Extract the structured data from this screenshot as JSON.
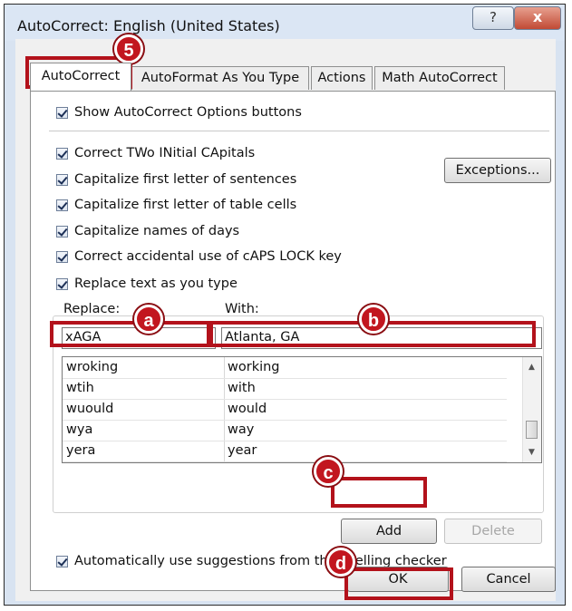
{
  "dialog": {
    "title": "AutoCorrect: English (United States)",
    "help_label": "?",
    "close_label": "x"
  },
  "tabs": [
    {
      "label": "AutoCorrect"
    },
    {
      "label": "AutoFormat As You Type"
    },
    {
      "label": "Actions"
    },
    {
      "label": "Math AutoCorrect"
    }
  ],
  "options": {
    "show_buttons": "Show AutoCorrect Options buttons",
    "correct_two_initial": "Correct TWo INitial CApitals",
    "cap_sentences": "Capitalize first letter of sentences",
    "cap_table_cells": "Capitalize first letter of table cells",
    "cap_days": "Capitalize names of days",
    "caps_lock": "Correct accidental use of cAPS LOCK key",
    "replace_as_type": "Replace text as you type",
    "auto_suggest": "Automatically use suggestions from the spelling checker"
  },
  "buttons": {
    "exceptions": "Exceptions...",
    "add": "Add",
    "delete": "Delete",
    "ok": "OK",
    "cancel": "Cancel"
  },
  "replace": {
    "replace_label": "Replace:",
    "with_label": "With:",
    "replace_value": "xAGA",
    "with_value": "Atlanta, GA",
    "entries": [
      {
        "from": "wroking",
        "to": "working"
      },
      {
        "from": "wtih",
        "to": "with"
      },
      {
        "from": "wuould",
        "to": "would"
      },
      {
        "from": "wya",
        "to": "way"
      },
      {
        "from": "yera",
        "to": "year"
      }
    ]
  },
  "callouts": {
    "step5": "5",
    "a": "a",
    "b": "b",
    "c": "c",
    "d": "d"
  },
  "colors": {
    "callout_red": "#b3121b"
  }
}
